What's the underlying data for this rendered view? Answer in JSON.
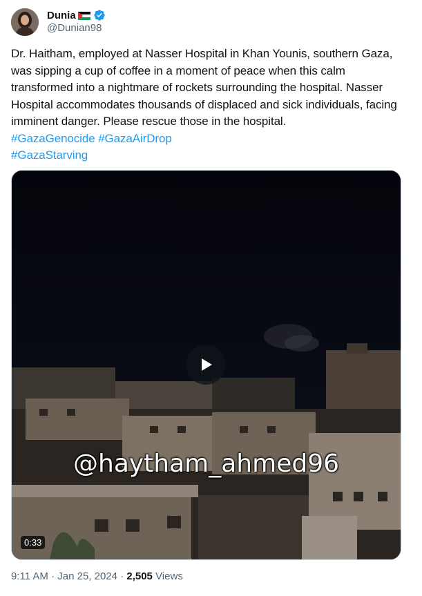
{
  "author": {
    "name": "Dunia",
    "handle": "@Dunian98"
  },
  "tweet": {
    "text": "Dr. Haitham, employed at Nasser Hospital in Khan Younis, southern Gaza, was sipping a cup of coffee in a moment of peace when this calm transformed into a nightmare of rockets surrounding the hospital. Nasser Hospital accommodates thousands of displaced and sick individuals, facing imminent danger. Please rescue those in the hospital.",
    "hashtags": [
      "#GazaGenocide",
      "#GazaAirDrop",
      "#GazaStarving"
    ]
  },
  "media": {
    "watermark": "@haytham_ahmed96",
    "duration": "0:33"
  },
  "meta": {
    "time": "9:11 AM",
    "separator": "·",
    "date": "Jan 25, 2024",
    "views_count": "2,505",
    "views_label": "Views"
  },
  "icons": {
    "verified": "verified-badge-icon",
    "flag": "palestine-flag-icon",
    "play": "play-icon"
  },
  "colors": {
    "link": "#1d9bf0",
    "verified": "#1d9bf0",
    "secondary_text": "#536471"
  }
}
